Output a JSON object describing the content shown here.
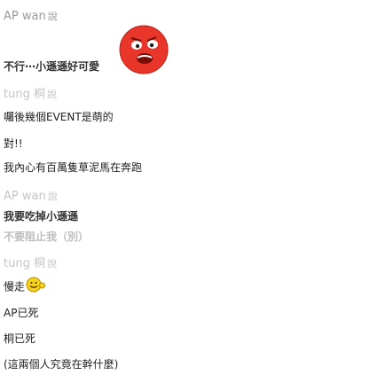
{
  "thread": {
    "messages": [
      {
        "speaker": "AP wan",
        "said": "說"
      },
      {
        "text": "不行⋯小遜遜好可愛"
      },
      {
        "speaker": "tung 桐",
        "said": "說"
      },
      {
        "text": "囑後幾個EVENT是萌的"
      },
      {
        "text": "對!!"
      },
      {
        "text": "我內心有百萬隻草泥馬在奔跑"
      },
      {
        "speaker": "AP wan",
        "said": "說"
      },
      {
        "text": "我要吃掉小遜遜"
      },
      {
        "text": "不要阻止我（別）"
      },
      {
        "speaker": "tung 桐",
        "said": "說"
      },
      {
        "text": "慢走"
      },
      {
        "text": "AP已死"
      },
      {
        "text": "桐已死"
      },
      {
        "text": "(這兩個人究竟在幹什麼)"
      }
    ]
  },
  "icons": {
    "sticker": "red-face-sticker-icon",
    "smiley": "smiley-face-icon"
  },
  "colors": {
    "sticker_red": "#e8362a",
    "smiley_yellow": "#f5d21b"
  }
}
